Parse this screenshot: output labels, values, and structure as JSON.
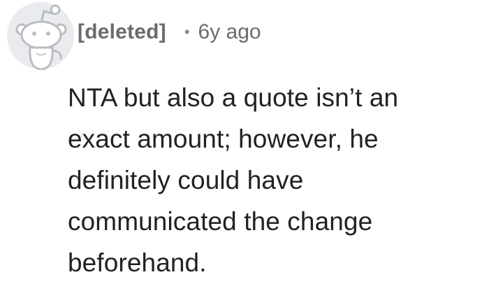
{
  "comment": {
    "author": "[deleted]",
    "separator": "•",
    "age": "6y ago",
    "body_lines": [
      "NTA but also a quote isn’t an",
      "exact amount; however, he",
      "definitely could have",
      "communicated the change",
      "beforehand."
    ],
    "avatar_icon": "snoo-avatar-icon"
  }
}
